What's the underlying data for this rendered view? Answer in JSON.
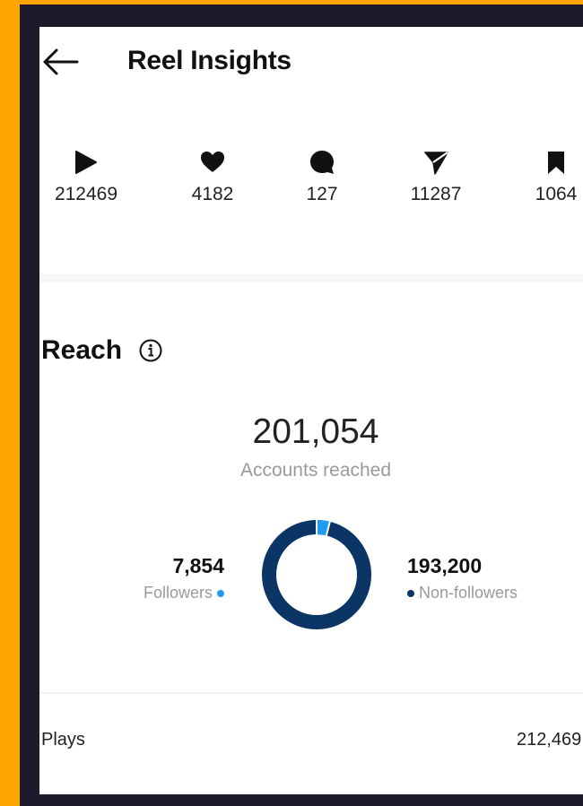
{
  "header": {
    "title": "Reel Insights",
    "back_icon": "arrow-left-icon"
  },
  "metrics": [
    {
      "icon": "play-icon",
      "value": "212469"
    },
    {
      "icon": "heart-icon",
      "value": "4182"
    },
    {
      "icon": "comment-icon",
      "value": "127"
    },
    {
      "icon": "share-icon",
      "value": "11287"
    },
    {
      "icon": "save-icon",
      "value": "1064"
    }
  ],
  "reach": {
    "title": "Reach",
    "info_icon": "info-icon",
    "accounts_reached": "201,054",
    "accounts_reached_label": "Accounts reached",
    "followers": {
      "value": "7,854",
      "label": "Followers",
      "fraction": 0.039,
      "color": "#1f9cf0"
    },
    "non_followers": {
      "value": "193,200",
      "label": "Non-followers",
      "fraction": 0.961,
      "color": "#0b3564"
    }
  },
  "plays_row": {
    "label": "Plays",
    "value": "212,469"
  },
  "colors": {
    "frame_outer": "#FFA500",
    "frame_inner": "#1e1a2c",
    "background": "#ffffff"
  }
}
